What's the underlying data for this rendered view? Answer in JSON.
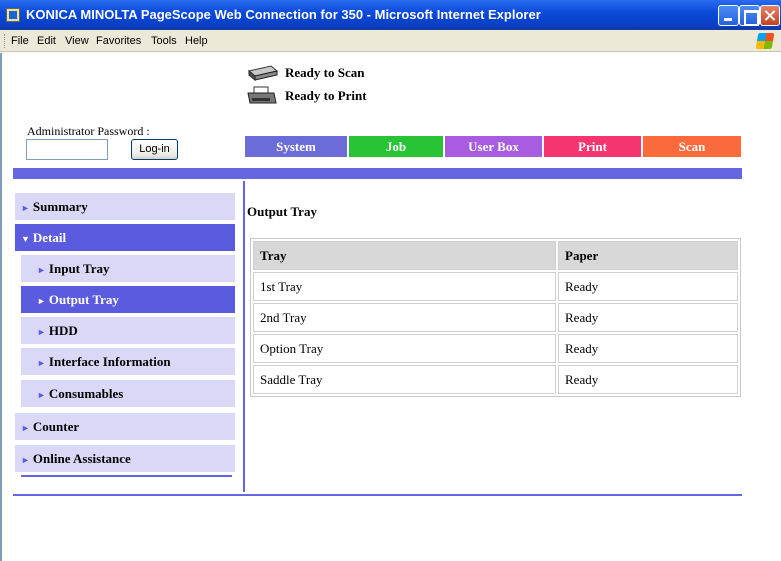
{
  "window": {
    "title": "KONICA MINOLTA PageScope Web Connection for 350 - Microsoft Internet Explorer"
  },
  "menu": [
    "File",
    "Edit",
    "View",
    "Favorites",
    "Tools",
    "Help"
  ],
  "status": {
    "scan": "Ready to Scan",
    "print": "Ready to Print"
  },
  "login": {
    "label": "Administrator Password :",
    "password_value": "",
    "button": "Log-in"
  },
  "tabs": [
    {
      "label": "System",
      "color": "#6c6cd8"
    },
    {
      "label": "Job",
      "color": "#29c436"
    },
    {
      "label": "User Box",
      "color": "#a85ce0"
    },
    {
      "label": "Print",
      "color": "#f4356f"
    },
    {
      "label": "Scan",
      "color": "#fb6a3c"
    }
  ],
  "sidebar": {
    "items": [
      {
        "label": "Summary",
        "arrow": "►"
      },
      {
        "label": "Detail",
        "arrow": "▼"
      },
      {
        "label": "Input Tray",
        "arrow": "►"
      },
      {
        "label": "Output Tray",
        "arrow": "►"
      },
      {
        "label": "HDD",
        "arrow": "►"
      },
      {
        "label": "Interface Information",
        "arrow": "►"
      },
      {
        "label": "Consumables",
        "arrow": "►"
      },
      {
        "label": "Counter",
        "arrow": "►"
      },
      {
        "label": "Online Assistance",
        "arrow": "►"
      }
    ]
  },
  "main": {
    "title": "Output Tray",
    "columns": [
      "Tray",
      "Paper"
    ],
    "rows": [
      [
        "1st Tray",
        "Ready"
      ],
      [
        "2nd Tray",
        "Ready"
      ],
      [
        "Option Tray",
        "Ready"
      ],
      [
        "Saddle Tray",
        "Ready"
      ]
    ]
  },
  "colors": {
    "accent": "#6666e3",
    "nav_bg": "#d9d9f7",
    "nav_active": "#5b5be0"
  }
}
